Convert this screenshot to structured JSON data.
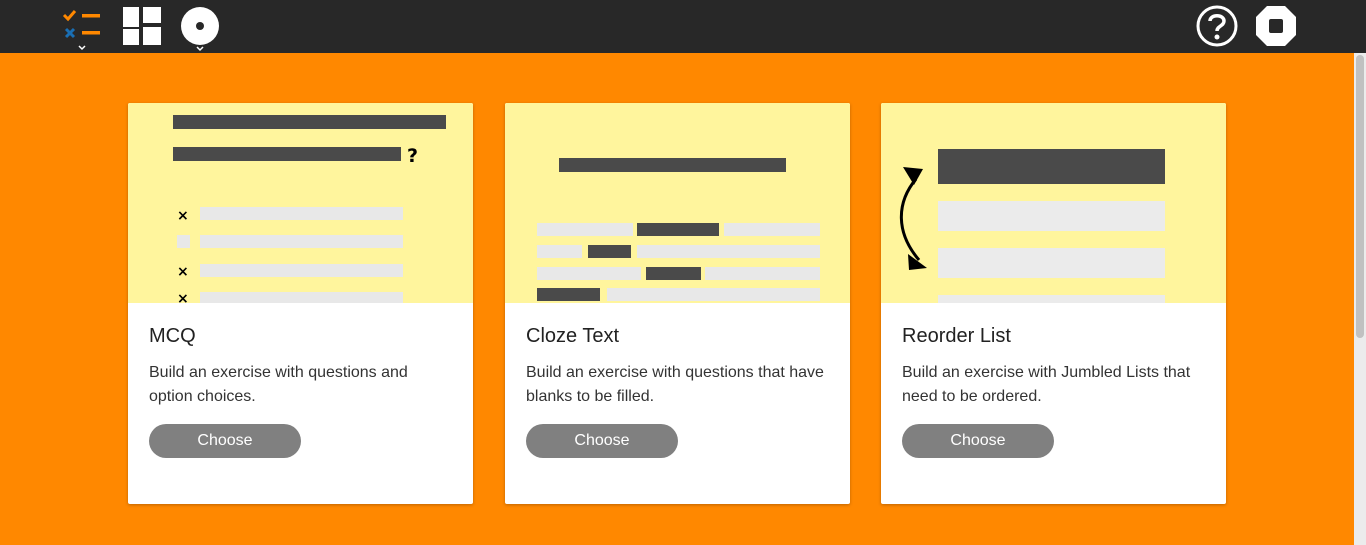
{
  "cards": [
    {
      "title": "MCQ",
      "description": "Build an exercise with questions and option choices.",
      "button_label": "Choose"
    },
    {
      "title": "Cloze Text",
      "description": "Build an exercise with questions that have blanks to be filled.",
      "button_label": "Choose"
    },
    {
      "title": "Reorder List",
      "description": "Build an exercise with Jumbled Lists that need to be ordered.",
      "button_label": "Choose"
    }
  ],
  "illustrations": {
    "mcq_question_mark": "?",
    "mcq_check_mark": "×"
  },
  "icons": {
    "toolbar_left": [
      "activity-list-icon",
      "layout-grid-icon",
      "record-icon"
    ],
    "toolbar_right": [
      "help-icon",
      "stop-icon"
    ]
  },
  "colors": {
    "toolbar": "#282828",
    "background": "#ff8800",
    "illustration": "#fff59d",
    "button": "#808080",
    "check_orange": "#ff8800",
    "cross_blue": "#1a6fb4"
  }
}
